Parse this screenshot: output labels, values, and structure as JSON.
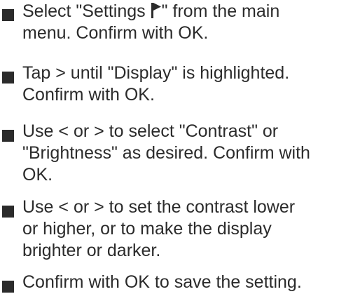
{
  "steps": [
    {
      "lines": [
        "Select  \"Settings ",
        "\" from the main",
        "menu. Confirm with OK."
      ],
      "icon": "flag-icon"
    },
    {
      "lines": [
        "Tap > until \"Display\" is highlighted.",
        "Confirm with OK."
      ]
    },
    {
      "lines": [
        "Use < or > to select \"Contrast\" or",
        "\"Brightness\" as desired. Confirm with",
        "OK."
      ]
    },
    {
      "lines": [
        "Use < or > to set the contrast lower",
        "or higher, or to make the display",
        "brighter or darker."
      ]
    },
    {
      "lines": [
        "Confirm with OK to save the setting."
      ]
    }
  ],
  "colors": {
    "text": "#2b2b2b",
    "bullet": "#2b2b2b",
    "background": "#ffffff"
  }
}
